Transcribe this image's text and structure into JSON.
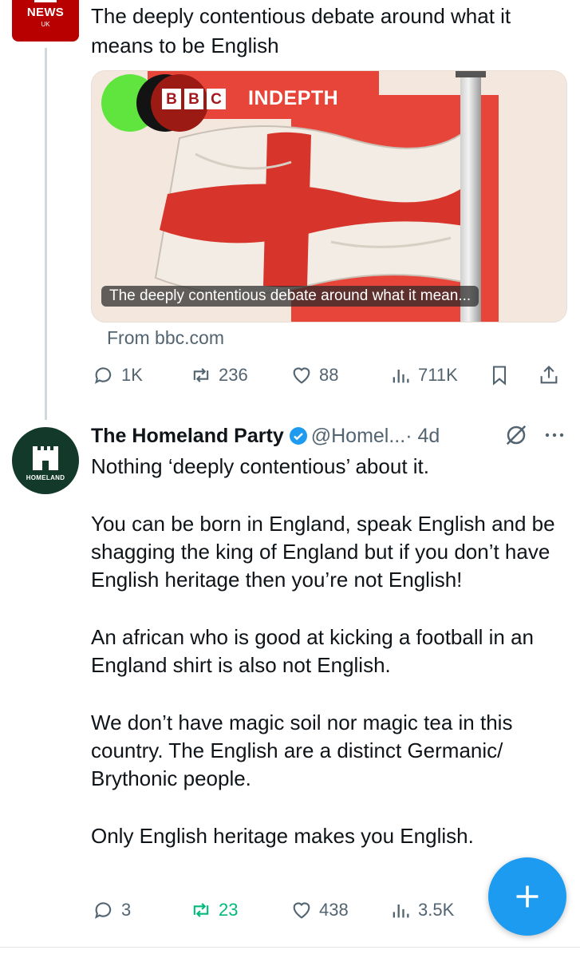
{
  "tweet1": {
    "avatar_label": "NEWS",
    "avatar_sublabel": "UK",
    "text": "The deeply contentious debate around what it means to be English",
    "card": {
      "brand_letters": [
        "B",
        "B",
        "C"
      ],
      "brand_label": "INDEPTH",
      "caption": "The deeply contentious debate around what it mean...",
      "source": "From bbc.com"
    },
    "stats": {
      "replies": "1K",
      "reposts": "236",
      "likes": "88",
      "views": "711K"
    }
  },
  "tweet2": {
    "avatar_label": "HOMELAND",
    "name": "The Homeland Party",
    "handle": "@Homel...",
    "time": "· 4d",
    "paragraphs": [
      "Nothing ‘deeply contentious’ about it.",
      "You can be born in England, speak English and be shagging the king of England but if you don’t have English heritage then you’re not English!",
      "An african who is good at kicking a football in an England shirt is also not English.",
      "We don’t have magic soil nor magic tea in this country. The English are a distinct Germanic/ Brythonic people.",
      "Only English heritage makes you English."
    ],
    "stats": {
      "replies": "3",
      "reposts": "23",
      "likes": "438",
      "views": "3.5K"
    }
  },
  "colors": {
    "accent": "#1d9bf0",
    "repost_active": "#00ba7c",
    "muted": "#536471",
    "bbc_red": "#b80000"
  },
  "icons": {
    "reply": "reply-icon",
    "repost": "repost-icon",
    "like": "heart-icon",
    "views": "views-icon",
    "bookmark": "bookmark-icon",
    "share": "share-icon",
    "compose": "plus-icon"
  }
}
